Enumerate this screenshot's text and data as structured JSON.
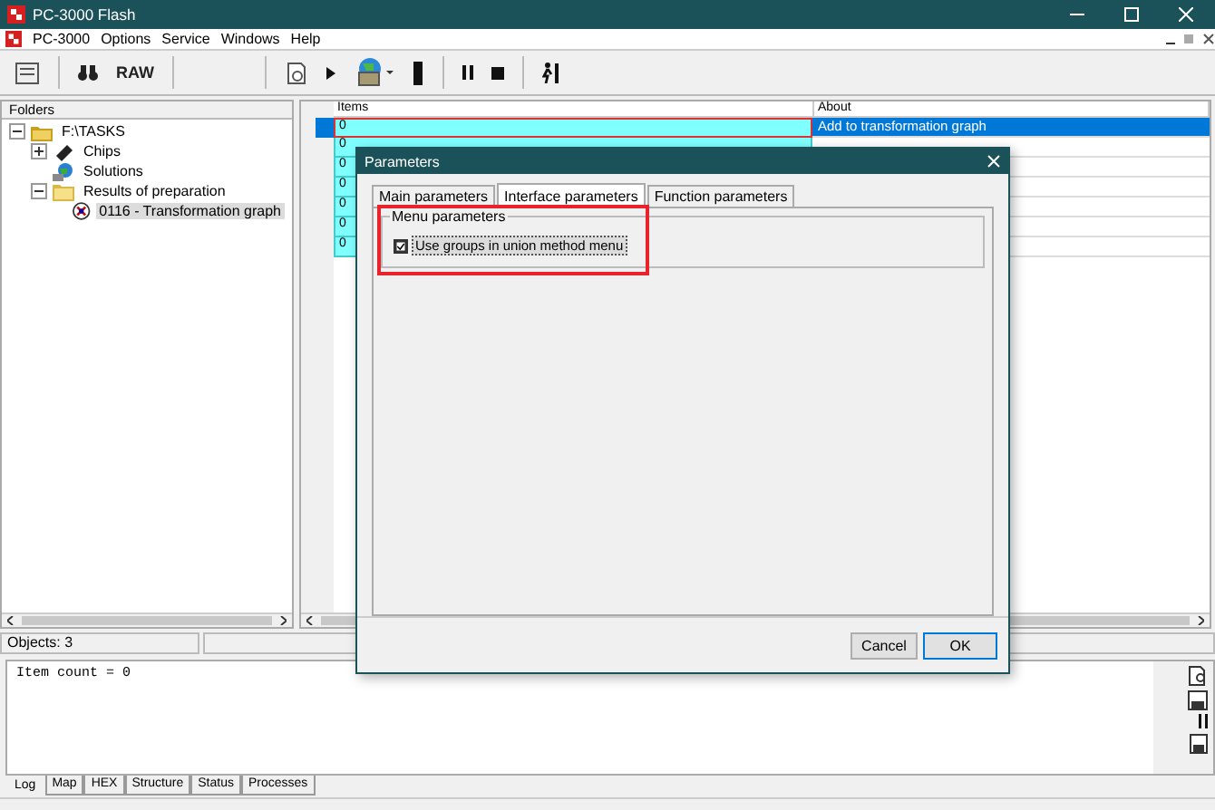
{
  "window": {
    "title": "PC-3000 Flash"
  },
  "menu": [
    {
      "label": "PC-3000"
    },
    {
      "label": "Options"
    },
    {
      "label": "Service"
    },
    {
      "label": "Windows"
    },
    {
      "label": "Help"
    }
  ],
  "toolbar": {
    "raw_label": "RAW"
  },
  "folders": {
    "title": "Folders",
    "tree": [
      {
        "label": "F:\\TASKS",
        "kind": "tasks",
        "expanded": true,
        "selected": false,
        "children": [
          {
            "label": "Chips",
            "kind": "chip",
            "expanded": false,
            "selected": false
          },
          {
            "label": "Solutions",
            "kind": "globe",
            "selected": false
          },
          {
            "label": "Results of preparation",
            "kind": "folder",
            "expanded": true,
            "selected": false,
            "children": [
              {
                "label": "0116 - Transformation graph",
                "kind": "graph",
                "selected": true
              }
            ]
          }
        ]
      }
    ]
  },
  "grid": {
    "columns": [
      "Items",
      "About"
    ],
    "rows": [
      {
        "items": "0",
        "about": "Add to transformation graph",
        "selected": true
      },
      {
        "items": "0",
        "selected": false
      },
      {
        "items": "0",
        "selected": false
      },
      {
        "items": "0",
        "selected": false
      },
      {
        "items": "0",
        "selected": false
      },
      {
        "items": "0",
        "selected": false
      },
      {
        "items": "0",
        "selected": false
      }
    ]
  },
  "status_bar": {
    "objects": "Objects: 3"
  },
  "log": {
    "text": "Item count = 0"
  },
  "bottom_tabs": [
    {
      "label": "Log",
      "selected": true
    },
    {
      "label": "Map",
      "selected": false
    },
    {
      "label": "HEX",
      "selected": false
    },
    {
      "label": "Structure",
      "selected": false
    },
    {
      "label": "Status",
      "selected": false
    },
    {
      "label": "Processes",
      "selected": false
    }
  ],
  "dialog": {
    "title": "Parameters",
    "tabs": [
      {
        "label": "Main parameters",
        "selected": false
      },
      {
        "label": "Interface parameters",
        "selected": true
      },
      {
        "label": "Function parameters",
        "selected": false
      }
    ],
    "group": "Menu parameters",
    "highlighted": true,
    "checkbox": {
      "label": "Use groups in union method menu",
      "checked": true
    },
    "buttons": [
      "Cancel",
      "OK"
    ]
  }
}
